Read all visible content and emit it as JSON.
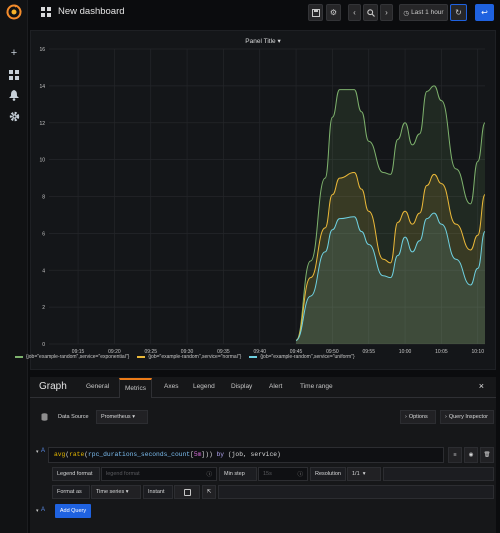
{
  "topbar": {
    "dashboard_title": "New dashboard",
    "time_range_label": "Last 1 hour",
    "buttons": [
      "save-icon",
      "settings-icon",
      "chevron-left-icon",
      "zoom-out-icon",
      "chevron-right-icon",
      "clock-icon",
      "refresh-icon",
      "back-icon"
    ]
  },
  "sidemenu": {
    "items": [
      "grafana-logo",
      "plus-icon",
      "dashboards-icon",
      "bell-icon",
      "gear-icon"
    ]
  },
  "panel": {
    "title": "Panel Title"
  },
  "chart_data": {
    "type": "area",
    "title": "Panel Title",
    "xlabel": "",
    "ylabel": "",
    "ylim": [
      0,
      16
    ],
    "yticks": [
      "0",
      "2",
      "4",
      "6",
      "8",
      "10",
      "12",
      "14",
      "16"
    ],
    "x_ticks": [
      "09:15",
      "09:20",
      "09:25",
      "09:30",
      "09:35",
      "09:40",
      "09:45",
      "09:50",
      "09:55",
      "10:00",
      "10:05",
      "10:10"
    ],
    "x_range": [
      "09:11",
      "10:11"
    ],
    "grid": true,
    "legend_position": "bottom",
    "x": [
      "09:45",
      "09:47",
      "09:49",
      "09:50",
      "09:51",
      "09:53",
      "09:54",
      "09:55",
      "09:57",
      "09:58",
      "09:59",
      "10:00",
      "10:01",
      "10:02",
      "10:03",
      "10:04",
      "10:05",
      "10:07",
      "10:09",
      "10:10",
      "10:11"
    ],
    "series": [
      {
        "name": "{job=\"example-random\",service=\"exponential\"}",
        "color": "#7eb26d",
        "values": [
          0.2,
          4.5,
          9.0,
          12.3,
          13.8,
          13.8,
          12.6,
          11.0,
          9.3,
          9.2,
          11.1,
          12.0,
          10.8,
          11.4,
          13.7,
          14.0,
          13.2,
          9.5,
          7.6,
          9.9,
          12.0
        ]
      },
      {
        "name": "{job=\"example-random\",service=\"normal\"}",
        "color": "#eab839",
        "values": [
          0.2,
          3.6,
          6.3,
          8.1,
          9.0,
          9.3,
          8.4,
          7.2,
          4.6,
          4.4,
          6.6,
          7.2,
          6.5,
          7.1,
          8.6,
          9.2,
          8.7,
          6.5,
          5.1,
          5.9,
          8.1
        ]
      },
      {
        "name": "{job=\"example-random\",service=\"uniform\"}",
        "color": "#6ed0e0",
        "values": [
          0.2,
          2.6,
          5.0,
          6.2,
          6.8,
          6.9,
          6.1,
          5.4,
          3.7,
          3.6,
          4.8,
          5.8,
          5.0,
          5.6,
          6.8,
          7.1,
          6.5,
          4.6,
          3.2,
          4.1,
          6.1
        ]
      }
    ]
  },
  "editor": {
    "title": "Graph",
    "tabs": [
      "General",
      "Metrics",
      "Axes",
      "Legend",
      "Display",
      "Alert",
      "Time range"
    ],
    "active_tab": "Metrics",
    "close_glyph": "×",
    "datasource_label": "Data Source",
    "datasource_value": "Prometheus",
    "options_label": "Options",
    "query_inspector_label": "Query Inspector",
    "query_ref": "A",
    "query_parts": {
      "fn1": "avg",
      "p1": "(",
      "fn2": "rate",
      "p2": "(",
      "metric": "rpc_durations_seconds_count",
      "range_open": "[",
      "range": "5m",
      "range_close": "]",
      "p3": "))",
      "by": " by ",
      "labels": "(job, service)"
    },
    "legend_format_label": "Legend format",
    "legend_format_placeholder": "legend format",
    "min_step_label": "Min step",
    "min_step_placeholder": "15s",
    "resolution_label": "Resolution",
    "resolution_value": "1/1",
    "format_as_label": "Format as",
    "format_as_value": "Time series",
    "instant_label": "Instant",
    "add_query_label": "Add Query",
    "add_ref": "A"
  }
}
